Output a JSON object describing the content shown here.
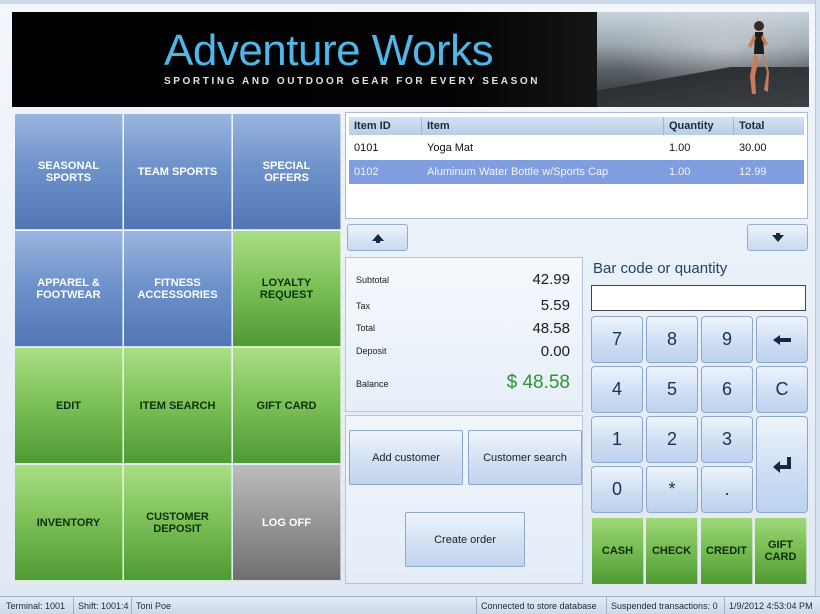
{
  "banner": {
    "brand_name": "Adventure Works",
    "tagline": "SPORTING AND OUTDOOR GEAR FOR EVERY SEASON"
  },
  "tiles": [
    {
      "label": "SEASONAL SPORTS",
      "color": "blue"
    },
    {
      "label": "TEAM SPORTS",
      "color": "blue"
    },
    {
      "label": "SPECIAL OFFERS",
      "color": "blue"
    },
    {
      "label": "APPAREL & FOOTWEAR",
      "color": "blue"
    },
    {
      "label": "FITNESS ACCESSORIES",
      "color": "blue"
    },
    {
      "label": "LOYALTY REQUEST",
      "color": "green"
    },
    {
      "label": "EDIT",
      "color": "green"
    },
    {
      "label": "ITEM SEARCH",
      "color": "green"
    },
    {
      "label": "GIFT CARD",
      "color": "green"
    },
    {
      "label": "INVENTORY",
      "color": "green"
    },
    {
      "label": "CUSTOMER DEPOSIT",
      "color": "green"
    },
    {
      "label": "LOG OFF",
      "color": "gray"
    }
  ],
  "grid": {
    "columns": [
      "Item ID",
      "Item",
      "Quantity",
      "Total"
    ],
    "rows": [
      {
        "item_id": "0101",
        "item": "Yoga Mat",
        "quantity": "1.00",
        "total": "30.00",
        "selected": false
      },
      {
        "item_id": "0102",
        "item": "Aluminum Water Bottle w/Sports Cap",
        "quantity": "1.00",
        "total": "12.99",
        "selected": true
      }
    ],
    "up_icon": "arrow-up-icon",
    "down_icon": "arrow-down-icon"
  },
  "totals": {
    "subtotal_label": "Subtotal",
    "subtotal": "42.99",
    "tax_label": "Tax",
    "tax": "5.59",
    "total_label": "Total",
    "total": "48.58",
    "deposit_label": "Deposit",
    "deposit": "0.00",
    "balance_label": "Balance",
    "balance": "$ 48.58",
    "balance_color": "#2d9531"
  },
  "actions": {
    "add_customer": "Add customer",
    "customer_search": "Customer search",
    "create_order": "Create order"
  },
  "keypad": {
    "bar_label": "Bar code or quantity",
    "input_value": "",
    "keys": [
      "7",
      "8",
      "9",
      "4",
      "5",
      "6",
      "1",
      "2",
      "3",
      "0",
      "*",
      "."
    ],
    "clear": "C",
    "backspace_icon": "backspace-arrow-icon",
    "enter_icon": "enter-icon"
  },
  "payments": [
    "CASH",
    "CHECK",
    "CREDIT",
    "GIFT CARD"
  ],
  "status": {
    "terminal": "Terminal: 1001",
    "shift": "Shift: 1001:4",
    "user": "Toni Poe",
    "connection": "Connected to store database",
    "suspended": "Suspended transactions: 0",
    "datetime": "1/9/2012 4:53:04 PM"
  },
  "colors": {
    "accent_blue": "#4fb7e8",
    "tile_blue": "#6f93cb",
    "tile_green": "#7fc25a",
    "tile_gray": "#9a9a9a",
    "selected_row": "#7f9ddf"
  }
}
